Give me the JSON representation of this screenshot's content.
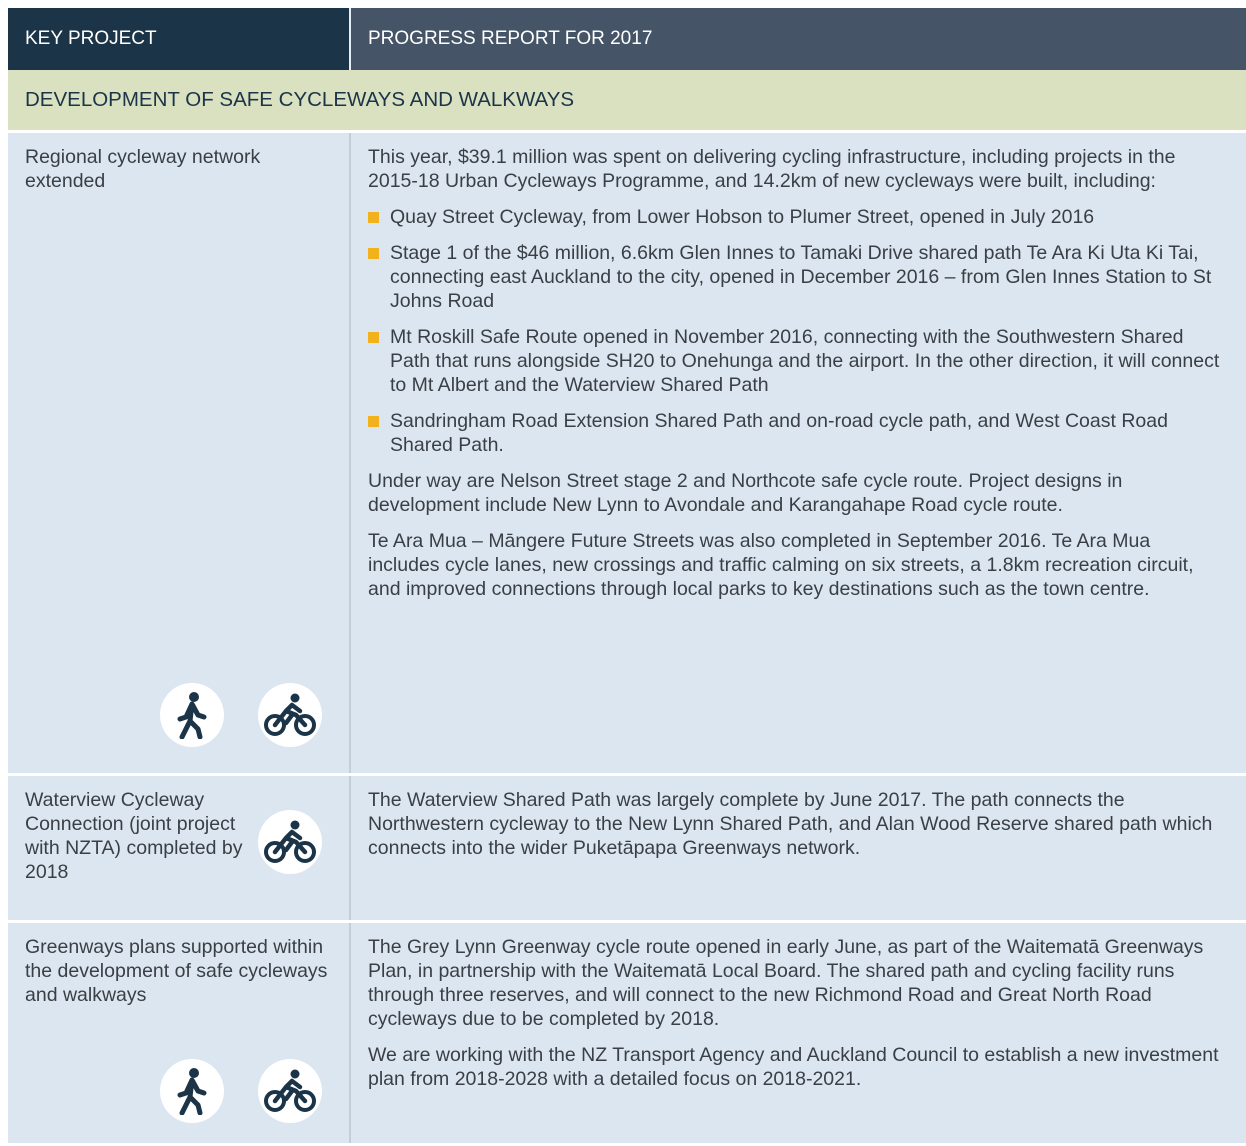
{
  "header": {
    "col1": "KEY PROJECT",
    "col2": "PROGRESS REPORT FOR 2017"
  },
  "section": {
    "title": "DEVELOPMENT OF SAFE CYCLEWAYS AND WALKWAYS"
  },
  "rows": [
    {
      "project": "Regional cycleway network extended",
      "intro": "This year, $39.1 million was spent on delivering cycling infrastructure, including projects in the 2015-18 Urban Cycleways Programme, and 14.2km of new cycleways were built, including:",
      "bullets": [
        "Quay Street Cycleway, from Lower Hobson to Plumer Street, opened in July 2016",
        "Stage 1 of the $46 million, 6.6km Glen Innes to Tamaki Drive shared path Te Ara Ki Uta Ki Tai, connecting east Auckland to the city, opened in December 2016 – from Glen Innes Station to St Johns Road",
        "Mt Roskill Safe Route opened in November 2016, connecting with the Southwestern Shared Path that runs alongside SH20 to Onehunga and the airport. In the other direction, it will connect to Mt Albert and the Waterview Shared Path",
        "Sandringham Road Extension Shared Path and on-road cycle path, and West Coast Road Shared Path."
      ],
      "para2": "Under way are Nelson Street stage 2 and Northcote safe cycle route. Project designs in development include New Lynn to Avondale and Karangahape Road cycle route.",
      "para3": "Te Ara Mua – Māngere Future Streets was also completed in September 2016. Te Ara Mua includes cycle lanes, new crossings and traffic calming on six streets, a 1.8km recreation circuit, and improved connections through local parks to key destinations such as the town centre.",
      "icons": [
        "walking-icon",
        "cycling-icon"
      ]
    },
    {
      "project": "Waterview Cycleway Connection (joint project with NZTA) completed by 2018",
      "para1": "The Waterview Shared Path was largely complete by June 2017. The path connects the Northwestern cycleway to the New Lynn Shared Path, and Alan Wood Reserve shared path which connects into the wider Puketāpapa Greenways network.",
      "icons": [
        "cycling-icon"
      ]
    },
    {
      "project": "Greenways plans supported within the development of safe cycleways and walkways",
      "para1": "The Grey Lynn Greenway cycle route opened in early June, as part of the Waitematā Greenways Plan, in partnership with the Waitematā Local Board. The shared path and cycling facility runs through three reserves, and will connect to the new Richmond Road and Great North Road cycleways due to be completed by 2018.",
      "para2": "We are working with the NZ Transport Agency and Auckland Council to establish a new investment plan from 2018-2028 with a detailed focus on 2018-2021.",
      "icons": [
        "walking-icon",
        "cycling-icon"
      ]
    }
  ],
  "colors": {
    "header_left": "#1c3448",
    "header_right": "#455467",
    "section_bg": "#d9e1c0",
    "row_bg": "#dbe6f0",
    "bullet": "#f2b21c",
    "icon": "#1c3448"
  }
}
